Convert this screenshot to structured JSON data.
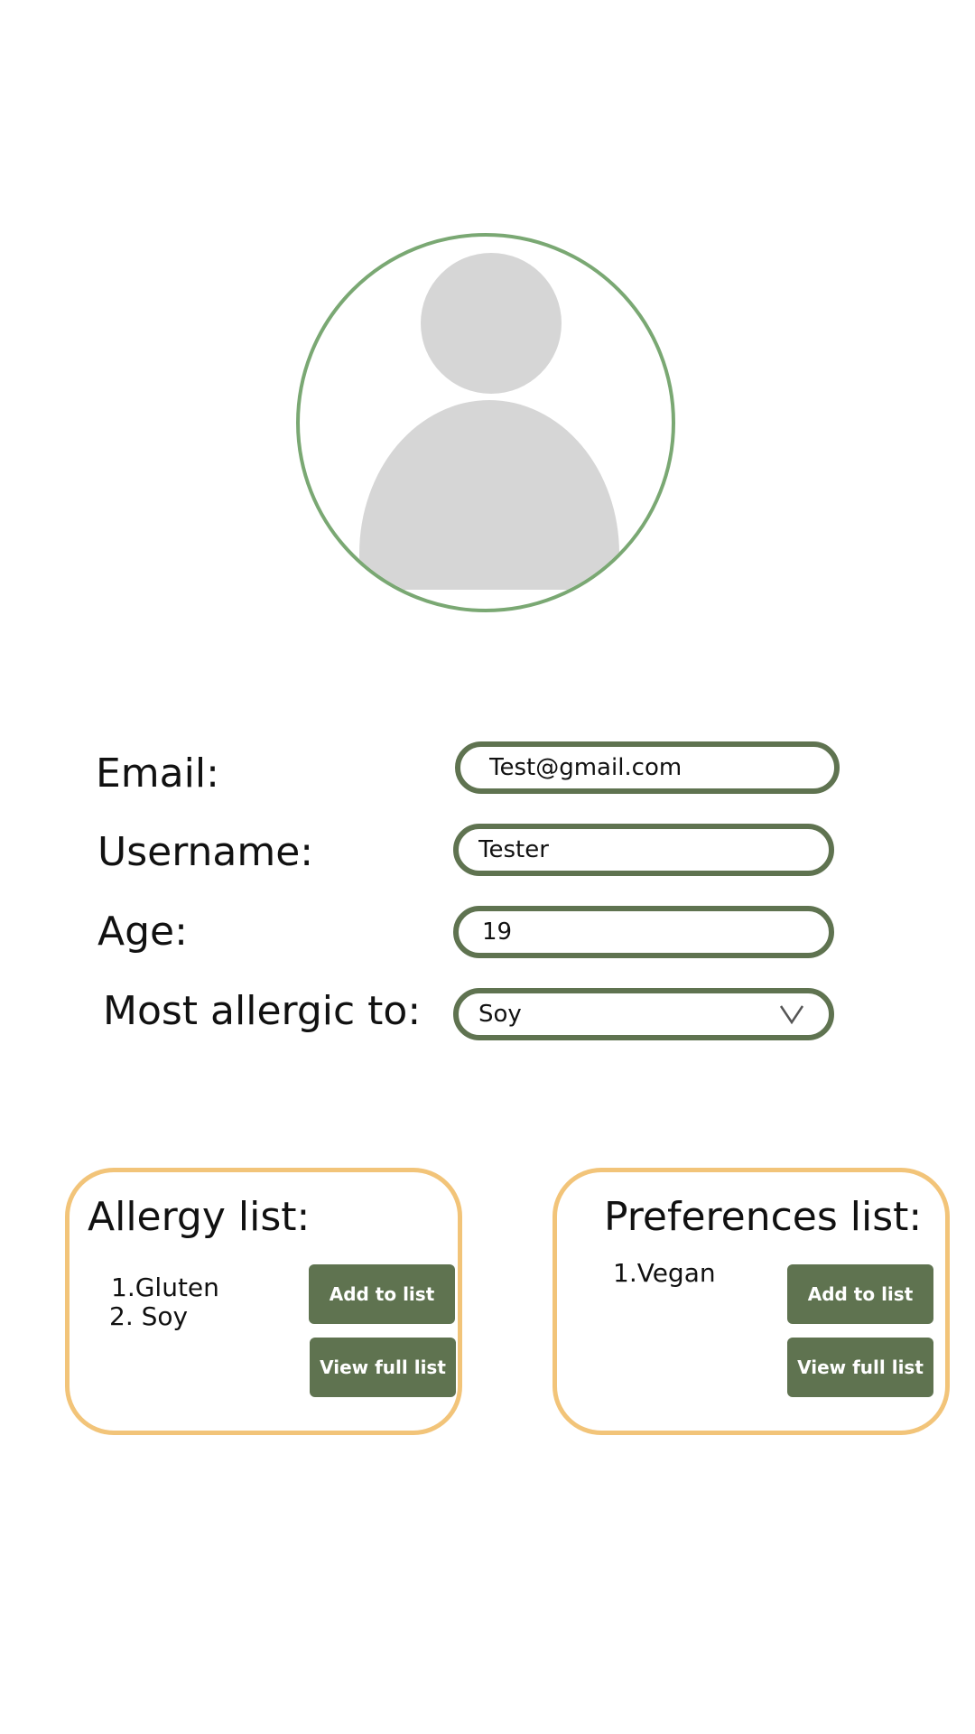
{
  "profile": {
    "avatar_icon": "user-avatar-icon",
    "ring_color": "#7aa873",
    "avatar_fill": "#d6d6d6"
  },
  "form": {
    "email_label": "Email:",
    "email_value": "Test@gmail.com",
    "username_label": "Username:",
    "username_value": "Tester",
    "age_label": "Age:",
    "age_value": "19",
    "allergy_label": "Most allergic to:",
    "allergy_value": "Soy",
    "allergy_chevron_icon": "chevron-down-icon",
    "field_border_color": "#5f7350"
  },
  "allergy_card": {
    "title": "Allergy list:",
    "items": [
      "1.Gluten",
      "2. Soy"
    ],
    "add_label": "Add to list",
    "view_label": "View full list"
  },
  "preferences_card": {
    "title": "Preferences list:",
    "items": [
      "1.Vegan"
    ],
    "add_label": "Add to list",
    "view_label": "View full list"
  },
  "colors": {
    "card_border": "#f2c479",
    "button_bg": "#5f7350",
    "button_text": "#ffffff"
  }
}
